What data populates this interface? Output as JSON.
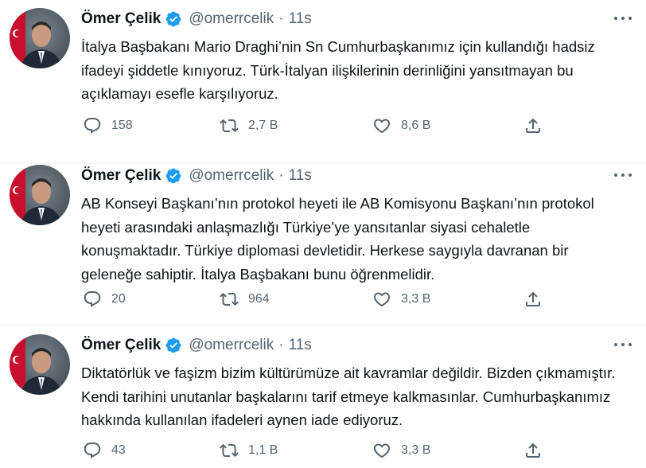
{
  "tweets": [
    {
      "author": "Ömer Çelik",
      "handle": "@omerrcelik",
      "separator": "·",
      "time": "11s",
      "text": "İtalya Başbakanı Mario Draghi’nin Sn Cumhurbaşkanımız için kullandığı hadsiz ifadeyi şiddetle kınıyoruz. Türk-İtalyan ilişkilerinin derinliğini yansıtmayan bu açıklamayı esefle karşılıyoruz.",
      "replies": "158",
      "retweets": "2,7 B",
      "likes": "8,6 B"
    },
    {
      "author": "Ömer Çelik",
      "handle": "@omerrcelik",
      "separator": "·",
      "time": "11s",
      "text": "AB Konseyi Başkanı’nın protokol heyeti ile AB Komisyonu Başkanı’nın protokol heyeti arasındaki anlaşmazlığı Türkiye’ye yansıtanlar siyasi cehaletle konuşmaktadır. Türkiye diplomasi devletidir. Herkese saygıyla davranan bir geleneğe sahiptir. İtalya Başbakanı bunu öğrenmelidir.",
      "replies": "20",
      "retweets": "964",
      "likes": "3,3 B"
    },
    {
      "author": "Ömer Çelik",
      "handle": "@omerrcelik",
      "separator": "·",
      "time": "11s",
      "text": "Diktatörlük ve faşizm bizim kültürümüze ait kavramlar değildir. Bizden çıkmamıştır. Kendi tarihini unutanlar başkalarını tarif etmeye kalkmasınlar. Cumhurbaşkanımız hakkında kullanılan ifadeleri aynen iade ediyoruz.",
      "replies": "43",
      "retweets": "1,1 B",
      "likes": "3,3 B"
    }
  ],
  "icons": {
    "reply": "reply-icon",
    "retweet": "retweet-icon",
    "like": "like-icon",
    "share": "share-icon",
    "verified": "verified-badge-icon",
    "more": "more-icon"
  },
  "colors": {
    "text": "#0f1419",
    "secondary": "#536471",
    "verified": "#1d9bf0",
    "divider": "#eff3f4"
  }
}
